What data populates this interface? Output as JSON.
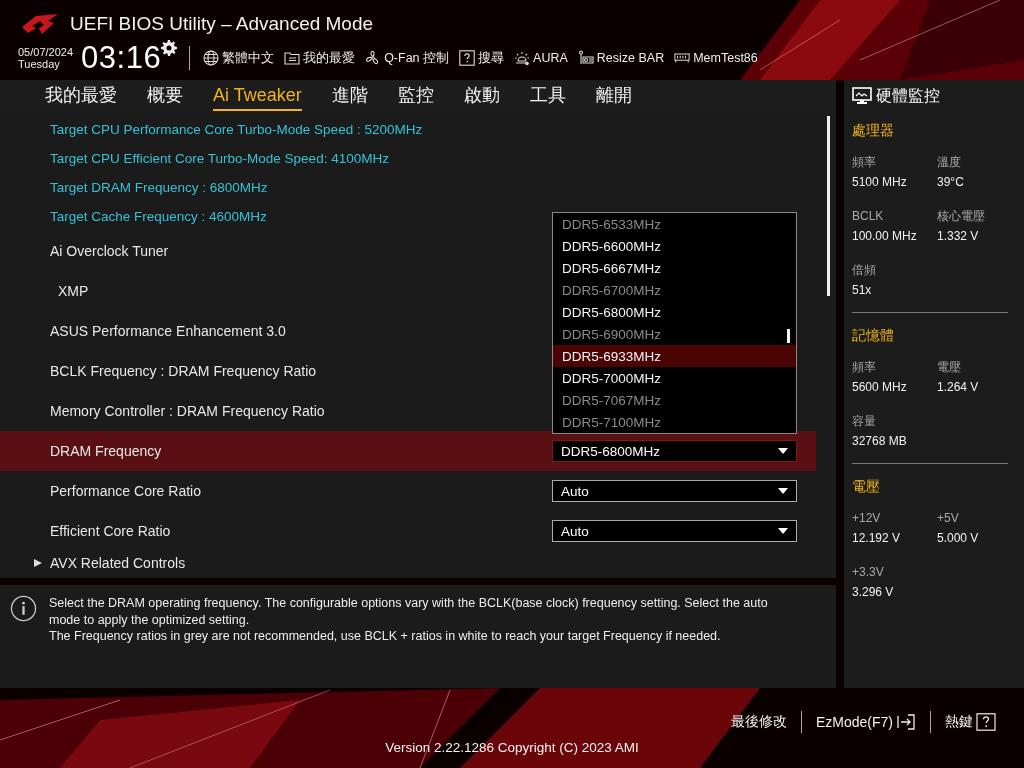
{
  "header": {
    "title": "UEFI BIOS Utility – Advanced Mode",
    "date": "05/07/2024",
    "weekday": "Tuesday",
    "time": "03:16",
    "toolbar": [
      {
        "label": "繁體中文"
      },
      {
        "label": "我的最愛"
      },
      {
        "label": "Q-Fan 控制"
      },
      {
        "label": "搜尋"
      },
      {
        "label": "AURA"
      },
      {
        "label": "Resize BAR"
      },
      {
        "label": "MemTest86"
      }
    ]
  },
  "tabs": [
    {
      "label": "我的最愛",
      "selected": false
    },
    {
      "label": "概要",
      "selected": false
    },
    {
      "label": "Ai Tweaker",
      "selected": true
    },
    {
      "label": "進階",
      "selected": false
    },
    {
      "label": "監控",
      "selected": false
    },
    {
      "label": "啟動",
      "selected": false
    },
    {
      "label": "工具",
      "selected": false
    },
    {
      "label": "離開",
      "selected": false
    }
  ],
  "settings": [
    {
      "kind": "info",
      "label": "Target CPU Performance Core Turbo-Mode Speed : 5200MHz",
      "selected": false
    },
    {
      "kind": "info",
      "label": "Target CPU Efficient Core Turbo-Mode Speed: 4100MHz",
      "selected": false
    },
    {
      "kind": "info",
      "label": "Target DRAM Frequency : 6800MHz",
      "selected": false
    },
    {
      "kind": "info",
      "label": "Target Cache Frequency : 4600MHz",
      "selected": false
    },
    {
      "kind": "setting",
      "label": "Ai Overclock Tuner",
      "selected": false
    },
    {
      "kind": "sub",
      "label": "XMP",
      "selected": false
    },
    {
      "kind": "setting",
      "label": "ASUS Performance Enhancement 3.0",
      "selected": false
    },
    {
      "kind": "setting",
      "label": "BCLK Frequency : DRAM Frequency Ratio",
      "selected": false
    },
    {
      "kind": "setting",
      "label": "Memory Controller : DRAM Frequency Ratio",
      "selected": false
    },
    {
      "kind": "setting",
      "label": "DRAM Frequency",
      "value": "DDR5-6800MHz",
      "selected": true
    },
    {
      "kind": "setting",
      "label": "Performance Core Ratio",
      "value": "Auto",
      "selected": false
    },
    {
      "kind": "setting",
      "label": "Efficient Core Ratio",
      "value": "Auto",
      "selected": false
    },
    {
      "kind": "submenu",
      "label": "AVX Related Controls",
      "selected": false
    }
  ],
  "dropdown": {
    "options": [
      {
        "label": "DDR5-6533MHz",
        "recommended": false,
        "selected": false
      },
      {
        "label": "DDR5-6600MHz",
        "recommended": true,
        "selected": false
      },
      {
        "label": "DDR5-6667MHz",
        "recommended": true,
        "selected": false
      },
      {
        "label": "DDR5-6700MHz",
        "recommended": false,
        "selected": false
      },
      {
        "label": "DDR5-6800MHz",
        "recommended": true,
        "selected": false
      },
      {
        "label": "DDR5-6900MHz",
        "recommended": false,
        "selected": false
      },
      {
        "label": "DDR5-6933MHz",
        "recommended": true,
        "selected": true
      },
      {
        "label": "DDR5-7000MHz",
        "recommended": true,
        "selected": false
      },
      {
        "label": "DDR5-7067MHz",
        "recommended": false,
        "selected": false
      },
      {
        "label": "DDR5-7100MHz",
        "recommended": false,
        "selected": false
      }
    ]
  },
  "help": {
    "lines": [
      "Select the DRAM operating frequency. The configurable options vary with the BCLK(base clock) frequency setting. Select the auto mode to apply the optimized setting.",
      "The Frequency ratios in grey are not recommended, use BCLK + ratios in white to reach your target Frequency if needed."
    ]
  },
  "monitor": {
    "title": "硬體監控",
    "sections": [
      {
        "title": "處理器",
        "stats": [
          {
            "label": "頻率",
            "value": "5100 MHz"
          },
          {
            "label": "溫度",
            "value": "39°C"
          },
          {
            "label": "BCLK",
            "value": "100.00 MHz"
          },
          {
            "label": "核心電壓",
            "value": "1.332 V"
          },
          {
            "label": "倍頻",
            "value": "51x"
          }
        ]
      },
      {
        "title": "記憶體",
        "stats": [
          {
            "label": "頻率",
            "value": "5600 MHz"
          },
          {
            "label": "電壓",
            "value": "1.264 V"
          },
          {
            "label": "容量",
            "value": "32768 MB"
          }
        ]
      },
      {
        "title": "電壓",
        "stats": [
          {
            "label": "+12V",
            "value": "12.192 V"
          },
          {
            "label": "+5V",
            "value": "5.000 V"
          },
          {
            "label": "+3.3V",
            "value": "3.296 V"
          }
        ]
      }
    ]
  },
  "footer": {
    "buttons": [
      {
        "label": "最後修改"
      },
      {
        "label": "EzMode(F7)"
      },
      {
        "label": "熱鍵"
      }
    ],
    "version": "Version 2.22.1286 Copyright (C) 2023 AMI"
  }
}
